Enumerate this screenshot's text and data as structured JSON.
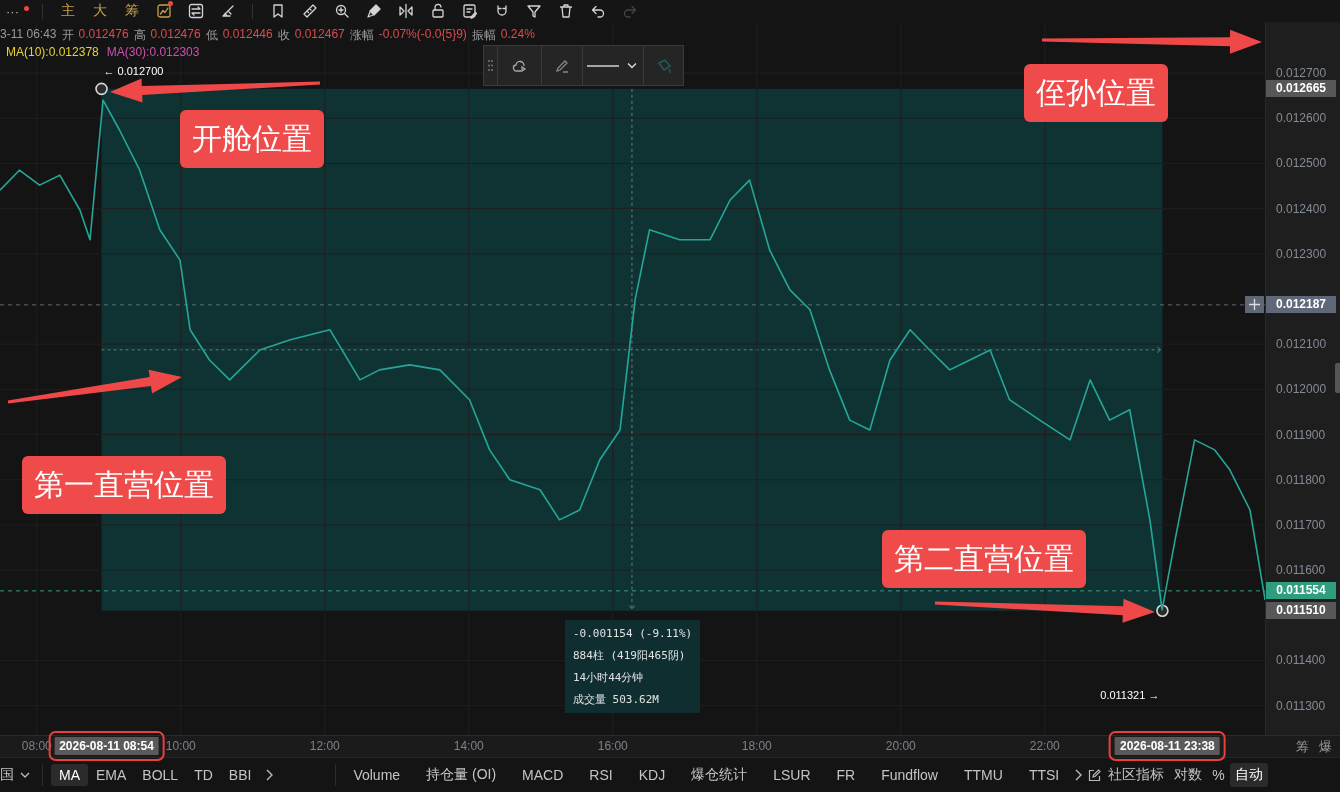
{
  "toolbar": {
    "menu": {
      "label": "···",
      "badge": true
    },
    "quick_buttons": [
      {
        "label": "主"
      },
      {
        "label": "大"
      },
      {
        "label": "筹"
      }
    ],
    "tools": [
      {
        "badge": true,
        "disabled": false
      },
      {
        "badge": false,
        "disabled": false
      },
      {
        "badge": false,
        "disabled": false
      },
      {
        "badge": false,
        "disabled": false
      },
      {
        "badge": false,
        "disabled": false
      },
      {
        "badge": false,
        "disabled": false
      },
      {
        "badge": false,
        "disabled": false
      },
      {
        "badge": false,
        "disabled": false
      },
      {
        "badge": false,
        "disabled": false
      },
      {
        "badge": false,
        "disabled": false
      },
      {
        "badge": false,
        "disabled": false
      },
      {
        "badge": false,
        "disabled": false
      },
      {
        "badge": false,
        "disabled": false
      },
      {
        "badge": false,
        "disabled": false
      },
      {
        "badge": false,
        "disabled": true
      }
    ]
  },
  "legend": {
    "time": "3-11 06:43",
    "ohlc": [
      {
        "label": "开",
        "value": "0.012476"
      },
      {
        "label": "高",
        "value": "0.012476"
      },
      {
        "label": "低",
        "value": "0.012446"
      },
      {
        "label": "收",
        "value": "0.012467"
      },
      {
        "label": "涨幅",
        "value": "-0.07%(-0.0{5}9)"
      },
      {
        "label": "振幅",
        "value": "0.24%"
      }
    ],
    "ma": [
      {
        "label": "MA(10):0.012378",
        "color": "#e8d430"
      },
      {
        "label": "MA(30):0.012303",
        "color": "#d04fb0"
      }
    ]
  },
  "chart": {
    "chart_data": {
      "type": "line",
      "xlim": [
        7.49,
        26.1
      ],
      "ylim": [
        0.011235,
        0.012813
      ],
      "grid": true,
      "ref_lines": [
        {
          "axis": "y",
          "value": 0.012187,
          "label": "0.012187",
          "color": "#5f6878"
        },
        {
          "axis": "y",
          "value": 0.011554,
          "label": "0.011554",
          "color": "#2f9e7f"
        }
      ],
      "x": [
        7.49,
        7.76,
        8.04,
        8.32,
        8.6,
        8.74,
        8.92,
        9.15,
        9.43,
        9.71,
        9.99,
        10.13,
        10.4,
        10.68,
        11.1,
        11.51,
        12.07,
        12.49,
        12.76,
        13.18,
        13.6,
        14.01,
        14.29,
        14.57,
        14.99,
        15.26,
        15.54,
        15.82,
        16.1,
        16.31,
        16.51,
        16.93,
        17.35,
        17.63,
        17.9,
        18.18,
        18.46,
        18.74,
        19.01,
        19.29,
        19.57,
        19.85,
        20.13,
        20.4,
        20.68,
        20.96,
        21.24,
        21.51,
        21.93,
        22.35,
        22.63,
        22.9,
        23.18,
        23.46,
        23.63,
        23.81,
        24.08,
        24.36,
        24.57,
        24.85,
        25.06
      ],
      "series": [
        {
          "color": "#26a69a",
          "values": [
            0.012441,
            0.012485,
            0.012452,
            0.012474,
            0.012397,
            0.012331,
            0.01264,
            0.012574,
            0.012485,
            0.012353,
            0.012286,
            0.012132,
            0.012065,
            0.012021,
            0.012087,
            0.012109,
            0.012132,
            0.012021,
            0.012043,
            0.012054,
            0.012043,
            0.011977,
            0.011866,
            0.0118,
            0.011778,
            0.011711,
            0.011733,
            0.011844,
            0.01191,
            0.012198,
            0.012353,
            0.012331,
            0.012331,
            0.012419,
            0.012463,
            0.012308,
            0.01222,
            0.012176,
            0.012043,
            0.011932,
            0.01191,
            0.012065,
            0.012132,
            0.012087,
            0.012043,
            0.012065,
            0.012087,
            0.011977,
            0.011932,
            0.011888,
            0.012021,
            0.011932,
            0.011955,
            0.011711,
            0.011512,
            0.011667,
            0.011888,
            0.011866,
            0.011822,
            0.011733,
            0.011534
          ]
        }
      ],
      "xticks": [
        {
          "value": 8,
          "label": "08:00"
        },
        {
          "value": 10,
          "label": "10:00"
        },
        {
          "value": 12,
          "label": "12:00"
        },
        {
          "value": 14,
          "label": "14:00"
        },
        {
          "value": 16,
          "label": "16:00"
        },
        {
          "value": 18,
          "label": "18:00"
        },
        {
          "value": 20,
          "label": "20:00"
        },
        {
          "value": 22,
          "label": "22:00"
        }
      ],
      "yticks": [
        {
          "value": 0.0127,
          "label": "0.012700"
        },
        {
          "value": 0.0126,
          "label": "0.012600"
        },
        {
          "value": 0.0125,
          "label": "0.012500"
        },
        {
          "value": 0.0124,
          "label": "0.012400"
        },
        {
          "value": 0.0123,
          "label": "0.012300"
        },
        {
          "value": 0.0121,
          "label": "0.012100"
        },
        {
          "value": 0.012,
          "label": "0.012000"
        },
        {
          "value": 0.0119,
          "label": "0.011900"
        },
        {
          "value": 0.0118,
          "label": "0.011800"
        },
        {
          "value": 0.0117,
          "label": "0.011700"
        },
        {
          "value": 0.0116,
          "label": "0.011600"
        },
        {
          "value": 0.0114,
          "label": "0.011400"
        },
        {
          "value": 0.0113,
          "label": "0.011300"
        }
      ]
    },
    "range": {
      "high_label": "← 0.012700",
      "low_label": "0.011321 →",
      "stats": [
        "-0.001154 (-9.11%)",
        "884柱 (419阳465阴)",
        "14小时44分钟",
        "成交量 503.62M"
      ]
    },
    "price_markers": [
      {
        "label": "0.012665",
        "kind": "range"
      },
      {
        "label": "0.011510",
        "kind": "range"
      }
    ],
    "time_markers": [
      {
        "label": "2026-08-11 08:54",
        "highlighted": true
      },
      {
        "label": "2026-08-11 23:38",
        "highlighted": true
      }
    ],
    "axis_corner": [
      "筹",
      "爆"
    ],
    "callouts": [
      {
        "text": "开舱位置"
      },
      {
        "text": "侄孙位置"
      },
      {
        "text": "第一直营位置"
      },
      {
        "text": "第二直营位置"
      }
    ]
  },
  "indicator_bar": {
    "period": "国",
    "main": [
      {
        "label": "MA",
        "selected": true
      },
      {
        "label": "EMA",
        "selected": false
      },
      {
        "label": "BOLL",
        "selected": false
      },
      {
        "label": "TD",
        "selected": false
      },
      {
        "label": "BBI",
        "selected": false
      }
    ],
    "sub": [
      {
        "label": "Volume",
        "selected": false
      },
      {
        "label": "持仓量 (OI)",
        "selected": false
      },
      {
        "label": "MACD",
        "selected": false
      },
      {
        "label": "RSI",
        "selected": false
      },
      {
        "label": "KDJ",
        "selected": false
      },
      {
        "label": "爆仓统计",
        "selected": false
      },
      {
        "label": "LSUR",
        "selected": false
      },
      {
        "label": "FR",
        "selected": false
      },
      {
        "label": "Fundflow",
        "selected": false
      },
      {
        "label": "TTMU",
        "selected": false
      },
      {
        "label": "TTSI",
        "selected": false
      }
    ],
    "options": [
      {
        "label": "社区指标",
        "selected": false
      },
      {
        "label": "对数",
        "selected": false
      },
      {
        "label": "%",
        "selected": false
      },
      {
        "label": "自动",
        "selected": true
      }
    ]
  }
}
